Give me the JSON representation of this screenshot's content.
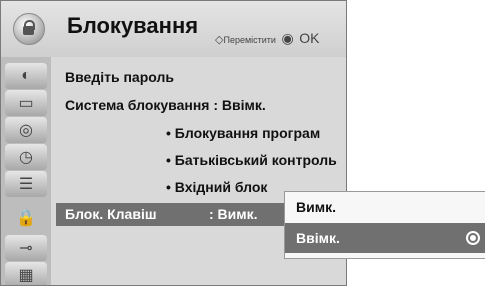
{
  "header": {
    "title": "Блокування",
    "hint_move": "Перемістити",
    "hint_ok": "OK"
  },
  "sidebar": {
    "items": [
      {
        "icon": "satellite-dish-icon"
      },
      {
        "icon": "tv-screen-icon"
      },
      {
        "icon": "speaker-icon"
      },
      {
        "icon": "clock-icon"
      },
      {
        "icon": "option-list-icon"
      },
      {
        "icon": "lock-icon"
      },
      {
        "icon": "input-plug-icon"
      },
      {
        "icon": "usb-media-icon"
      }
    ]
  },
  "content": {
    "password_label": "Введіть пароль",
    "system_lock": "Система блокування : Ввімк.",
    "block_programs": "• Блокування програм",
    "parental_control": "• Батьківський контроль",
    "input_block": "• Вхідний блок",
    "key_lock_label": "Блок. Клавіш",
    "key_lock_value": ": Вимк."
  },
  "popup": {
    "options": [
      "Вимк.",
      "Ввімк."
    ],
    "selected": "Ввімк."
  },
  "colors": {
    "highlight": "#707070",
    "menu_bg": "#d9d9d9"
  }
}
